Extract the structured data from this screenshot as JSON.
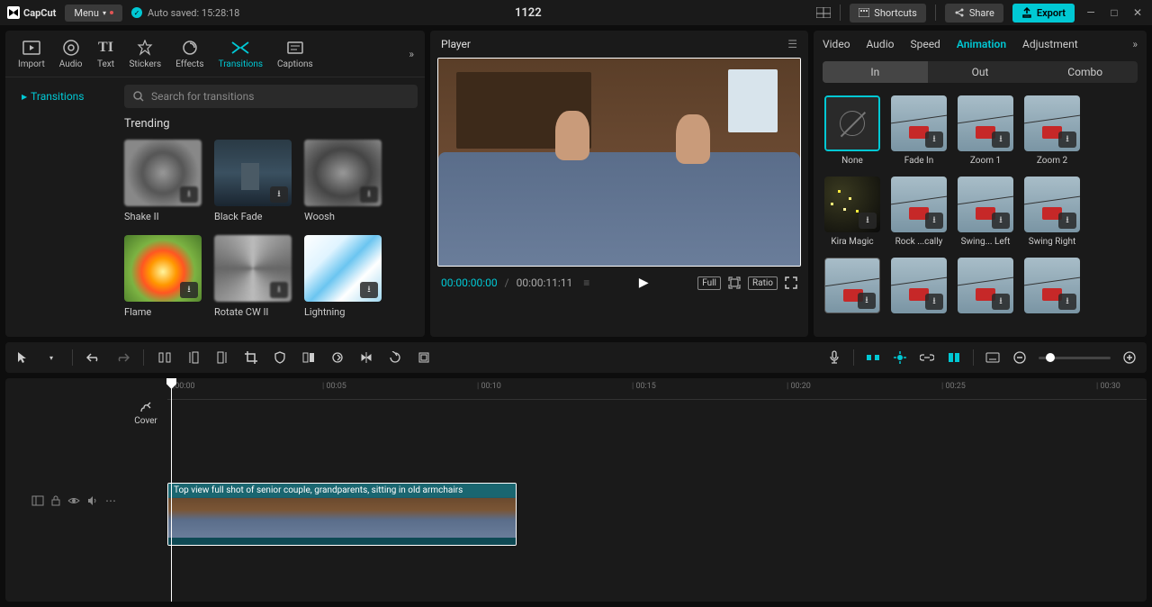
{
  "app": {
    "name": "CapCut",
    "menu": "Menu",
    "autosave": "Auto saved: 15:28:18",
    "title": "1122"
  },
  "topbar": {
    "shortcuts": "Shortcuts",
    "share": "Share",
    "export": "Export"
  },
  "leftTabs": {
    "import": "Import",
    "audio": "Audio",
    "text": "Text",
    "stickers": "Stickers",
    "effects": "Effects",
    "transitions": "Transitions",
    "captions": "Captions"
  },
  "leftSide": {
    "transitions": "Transitions"
  },
  "search": {
    "placeholder": "Search for transitions"
  },
  "sections": {
    "trending": "Trending"
  },
  "transitions_list": {
    "shake": "Shake II",
    "blackfade": "Black Fade",
    "woosh": "Woosh",
    "flame": "Flame",
    "rotate": "Rotate CW II",
    "lightning": "Lightning"
  },
  "player": {
    "label": "Player",
    "cur": "00:00:00:00",
    "sep": "/",
    "tot": "00:00:11:11",
    "full": "Full",
    "ratio": "Ratio"
  },
  "rightTabs": {
    "video": "Video",
    "audio": "Audio",
    "speed": "Speed",
    "animation": "Animation",
    "adjustment": "Adjustment"
  },
  "subtabs": {
    "in": "In",
    "out": "Out",
    "combo": "Combo"
  },
  "animations": {
    "none": "None",
    "fadein": "Fade In",
    "zoom1": "Zoom 1",
    "zoom2": "Zoom 2",
    "kira": "Kira Magic",
    "rock": "Rock ...cally",
    "swingl": "Swing... Left",
    "swingr": "Swing Right"
  },
  "timeline": {
    "cover": "Cover",
    "marks": [
      "00:00",
      "00:05",
      "00:10",
      "00:15",
      "00:20",
      "00:25",
      "00:30"
    ],
    "clip_label": "Top view full shot of senior couple, grandparents, sitting in old armchairs"
  }
}
